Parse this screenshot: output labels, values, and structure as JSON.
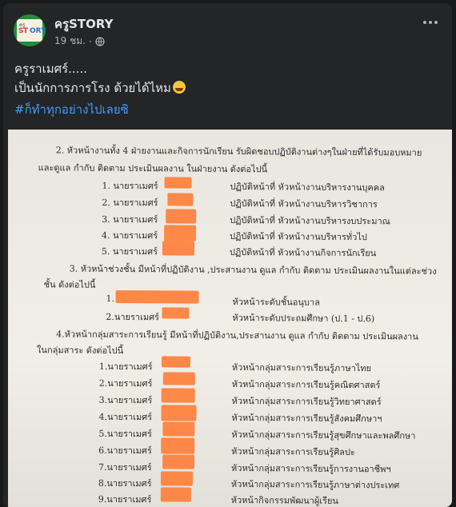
{
  "post": {
    "page_name": "ครูSTORY",
    "time": "19 ชม.",
    "separator": "·",
    "text_line1": "ครูราเมศร์.....",
    "text_line2": "เป็นนักการภารโรง ด้วยได้ไหม",
    "hashtag": "#ก็ทำทุกอย่างไปเลยซิ"
  },
  "icons": {
    "avatar": "page-avatar",
    "privacy": "globe-icon",
    "more": "more-options-icon",
    "emoji": "grinning-squinting-emoji"
  },
  "document": {
    "heading2": "2. หัวหน้างานทั้ง 4 ฝ่ายงานและกิจการนักเรียน รับผิดชอบปฏิบัติงานต่างๆในฝ่ายที่ได้รับมอบหมาย",
    "heading2b": "และดูแล กำกับ  ติดตาม ประเมินผลงาน  ในฝ่ายงาน  ดังต่อไปนี้",
    "list2": [
      {
        "num": "1. นายราเมศร์",
        "duty": "ปฏิบัติหน้าที่  หัวหน้างานบริหารงานบุคคล"
      },
      {
        "num": "2. นายราเมศร์",
        "duty": "ปฏิบัติหน้าที่  หัวหน้างานบริหารวิชาการ"
      },
      {
        "num": "3. นายราเมศร์",
        "duty": "ปฏิบัติหน้าที่  หัวหน้างานบริหารงบประมาณ"
      },
      {
        "num": "4. นายราเมศร์",
        "duty": "ปฏิบัติหน้าที่  หัวหน้างานบริหารทั่วไป"
      },
      {
        "num": "5. นายราเมศร์",
        "duty": "ปฏิบัติหน้าที่   หัวหน้างานกิจการนักเรียน"
      }
    ],
    "heading3": "3. หัวหน้าช่วงชั้น มีหน้าที่ปฏิบัติงาน ,ประสานงาน  ดูแล กำกับ  ติดตาม ประเมินผลงานในแต่ละช่วง",
    "heading3b": "ชั้น  ดังต่อไปนี้",
    "list3": [
      {
        "num": "1.",
        "duty": "หัวหน้าระดับชั้นอนุบาล"
      },
      {
        "num": "2.นายราเมศร์",
        "duty": "หัวหน้าระดับประถมศึกษา  (ป.1 - ป.6)"
      }
    ],
    "heading4": "4.หัวหน้ากลุ่มสาระการเรียนรู้ มีหน้าที่ปฏิบัติงาน,ประสานงาน  ดูแล กำกับ  ติดตาม ประเมินผลงาน",
    "heading4b": "ในกลุ่มสาระ  ดังต่อไปนี้",
    "list4": [
      {
        "num": "1.นายราเมศร์",
        "duty": "หัวหน้ากลุ่มสาระการเรียนรู้ภาษาไทย"
      },
      {
        "num": "2.นายราเมศร์",
        "duty": "หัวหน้ากลุ่มสาระการเรียนรู้คณิตศาสตร์"
      },
      {
        "num": "3.นายราเมศร์",
        "duty": "หัวหน้ากลุ่มสาระการเรียนรู้วิทยาศาสตร์"
      },
      {
        "num": "4.นายราเมศร์",
        "duty": "หัวหน้ากลุ่มสาระการเรียนรู้สังคมศึกษาฯ"
      },
      {
        "num": "5.นายราเมศร์",
        "duty": "หัวหน้ากลุ่มสาระการเรียนรู้สุขศึกษาและพลศึกษา"
      },
      {
        "num": "6.นายราเมศร์",
        "duty": "หัวหน้ากลุ่มสาระการเรียนรู้ศิลปะ"
      },
      {
        "num": "7.นายราเมศร์",
        "duty": "หัวหน้ากลุ่มสาระการเรียนรู้การงานอาชีพฯ"
      },
      {
        "num": "8.นายราเมศร์",
        "duty": "หัวหน้ากลุ่มสาระการเรียนรู้ภาษาต่างประเทศ"
      },
      {
        "num": "9.นายราเมศร์",
        "duty": "หัวหน้ากิจกรรมพัฒนาผู้เรียน"
      }
    ]
  },
  "colors": {
    "background": "#18191a",
    "card": "#242526",
    "text": "#e4e6eb",
    "secondary": "#b0b3b8",
    "link": "#4599ff",
    "redaction": "#ff7f3a"
  }
}
